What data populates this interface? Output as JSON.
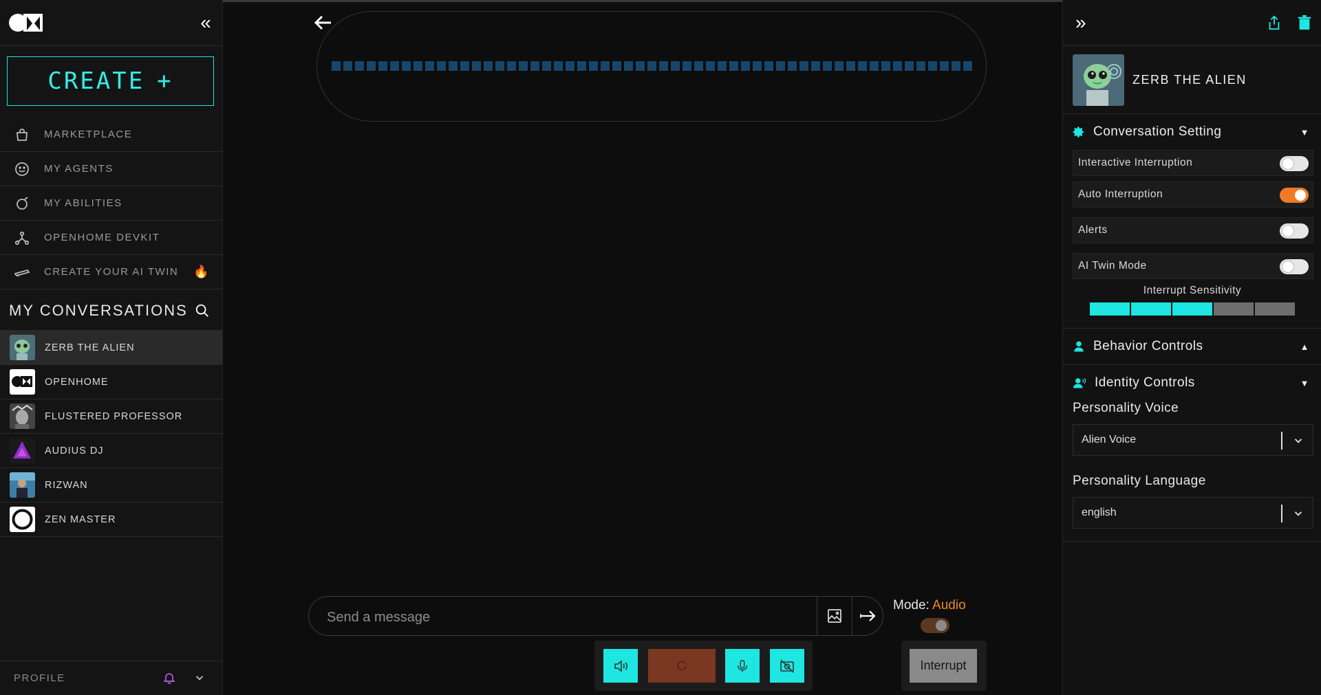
{
  "sidebar": {
    "create_label": "CREATE",
    "menu": [
      {
        "label": "MARKETPLACE",
        "icon": "bag-icon"
      },
      {
        "label": "MY AGENTS",
        "icon": "smiley-icon"
      },
      {
        "label": "MY ABILITIES",
        "icon": "ability-icon"
      },
      {
        "label": "OPENHOME DEVKIT",
        "icon": "devkit-icon"
      },
      {
        "label": "CREATE YOUR AI TWIN",
        "icon": "twin-icon"
      }
    ],
    "conversations_title": "MY CONVERSATIONS",
    "conversations": [
      {
        "name": "ZERB THE ALIEN",
        "active": true
      },
      {
        "name": "OPENHOME"
      },
      {
        "name": "FLUSTERED PROFESSOR"
      },
      {
        "name": "AUDIUS DJ"
      },
      {
        "name": "RIZWAN"
      },
      {
        "name": "ZEN MASTER"
      }
    ],
    "profile_label": "PROFILE"
  },
  "main": {
    "composer_placeholder": "Send a message",
    "mode_label": "Mode:",
    "mode_value": "Audio",
    "interrupt_label": "Interrupt"
  },
  "panel": {
    "agent_name": "ZERB THE ALIEN",
    "conversation_setting": "Conversation Setting",
    "settings": [
      {
        "label": "Interactive Interruption",
        "on": false
      },
      {
        "label": "Auto Interruption",
        "on": true
      },
      {
        "label": "Alerts",
        "on": false
      },
      {
        "label": "AI Twin Mode",
        "on": false
      }
    ],
    "sensitivity_label": "Interrupt Sensitivity",
    "sensitivity_level": 3,
    "sensitivity_max": 5,
    "behavior_controls": "Behavior Controls",
    "identity_controls": "Identity Controls",
    "voice_label": "Personality Voice",
    "voice_value": "Alien Voice",
    "language_label": "Personality Language",
    "language_value": "english"
  },
  "colors": {
    "accent_cyan": "#1ee6e0",
    "accent_orange": "#f07a23",
    "wave_blue": "#17466b",
    "stop_red": "#7a3722"
  }
}
